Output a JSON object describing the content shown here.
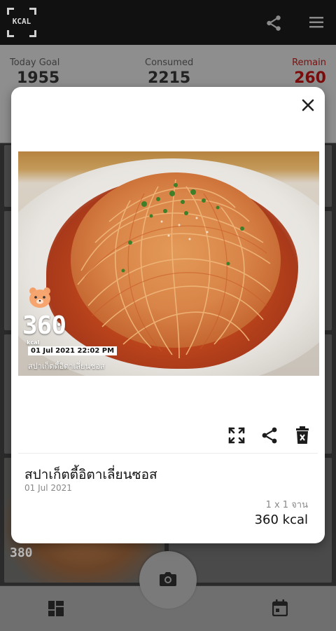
{
  "app": {
    "logo_text": "KCAL",
    "icons": {
      "share": "share-icon",
      "menu": "hamburger-menu-icon"
    }
  },
  "summary": {
    "goal_label": "Today Goal",
    "goal_value": "1955",
    "consumed_label": "Consumed",
    "consumed_value": "2215",
    "remain_label": "Remain",
    "remain_value": "260"
  },
  "background_tile": {
    "kcal_peek": "380"
  },
  "modal": {
    "photo_overlay": {
      "kcal": "360",
      "unit": "kcal",
      "datetime": "01 Jul 2021 22:02 PM",
      "name": "สปาเก็ตตี้อิตาเลี่ยนซอส"
    },
    "icons": {
      "close": "close-icon",
      "expand": "fullscreen-icon",
      "share": "share-icon",
      "delete": "delete-icon"
    },
    "food": {
      "name": "สปาเก็ตตี้อิตาเลี่ยนซอส",
      "date": "01 Jul 2021",
      "quantity": "1 x 1 จาน",
      "kcal": "360 kcal"
    }
  },
  "bottom_nav": {
    "icons": {
      "dashboard": "dashboard-icon",
      "camera": "camera-icon",
      "calendar": "calendar-icon"
    }
  },
  "colors": {
    "remain": "#C62828",
    "overlay_dim": "#000000",
    "modal_bg": "#FFFFFF"
  }
}
